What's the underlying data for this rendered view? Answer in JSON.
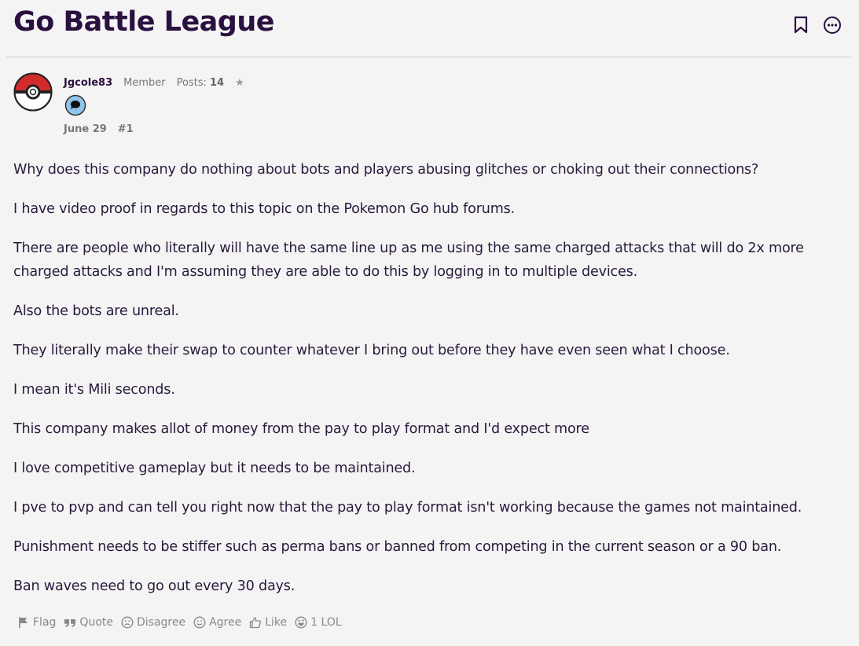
{
  "header": {
    "title": "Go Battle League"
  },
  "post": {
    "author": "Jgcole83",
    "role": "Member",
    "posts_label": "Posts:",
    "posts_count": "14",
    "star": "★",
    "date": "June 29",
    "permalink": "#1",
    "paragraphs": [
      "Why does this company do nothing about bots and players abusing glitches or choking out their connections?",
      "I have video proof in regards to this topic on the Pokemon Go hub forums.",
      "There are people who literally will have the same line up as me using the same charged attacks that will do 2x more charged attacks and I'm assuming they are able to do this by logging in to multiple devices.",
      "Also the bots are unreal.",
      "They literally make their swap to counter whatever I bring out before they have even seen what I choose.",
      "I mean it's Mili seconds.",
      "This company makes allot of money from the pay to play format and I'd expect more",
      "I love competitive gameplay but it needs to be maintained.",
      "I pve to pvp and can tell you right now that the pay to play format isn't working because the games not maintained.",
      "Punishment needs to be stiffer such as perma bans or banned from competing in the current season or a 90 ban.",
      "Ban waves need to go out every 30 days."
    ]
  },
  "reactions": {
    "flag": "Flag",
    "quote": "Quote",
    "disagree": "Disagree",
    "agree": "Agree",
    "like": "Like",
    "lol": "1 LOL"
  },
  "icons": {
    "bookmark": "bookmark-icon",
    "options": "more-options-icon",
    "avatar": "pokeball-avatar",
    "badge": "comment-badge-icon"
  },
  "colors": {
    "title": "#2a1040",
    "background": "#f4f4f4",
    "pokeball_red": "#d12b2b"
  }
}
